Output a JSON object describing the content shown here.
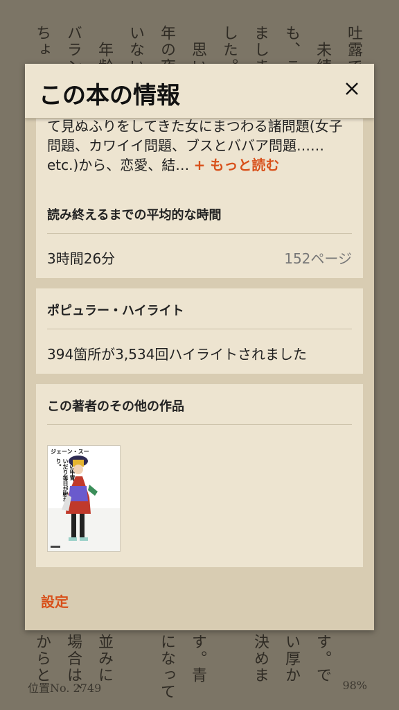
{
  "background": {
    "columns": [
      {
        "top": "ちょ",
        "bottom": "からと"
      },
      {
        "top": "バラン",
        "bottom": "場合は、"
      },
      {
        "top": "年齢",
        "bottom": "並みに"
      },
      {
        "top": "いない",
        "bottom": ""
      },
      {
        "top": "年の夜",
        "bottom": "になって"
      },
      {
        "top": "思い",
        "bottom": "す。青"
      },
      {
        "top": "した。",
        "bottom": ""
      },
      {
        "top": "まします",
        "bottom": "決めま"
      },
      {
        "top": "も、こ",
        "bottom": "い厚か"
      },
      {
        "top": "未練",
        "bottom": "す。で"
      },
      {
        "top": "吐露で",
        "bottom": ""
      }
    ],
    "location": "位置No. 2749",
    "percent": "98%"
  },
  "dialog": {
    "title": "この本の情報",
    "close_icon": "close-icon",
    "description": {
      "text": "て見ぬふりをしてきた女にまつわる諸問題(女子問題、カワイイ問題、ブスとババア問題……etc.)から、恋愛、結…",
      "more_label": "+ もっと読む"
    },
    "reading_time": {
      "heading": "読み終えるまでの平均的な時間",
      "time": "3時間26分",
      "pages": "152ページ"
    },
    "popular_highlights": {
      "heading": "ポピュラー・ハイライト",
      "summary": "394箇所が3,534回ハイライトされました"
    },
    "other_books": {
      "heading": "この著者のその他の作品",
      "books": [
        {
          "cover_author": "ジェーン・スー",
          "cover_title": "女の甲冑、着たり脱いだり毎日が戦なり。"
        }
      ]
    },
    "settings_label": "設定"
  },
  "colors": {
    "accent": "#d8501a",
    "dialog_bg": "#d8ccb2",
    "card_bg": "#ede4d0",
    "page_bg": "#7c7566"
  }
}
